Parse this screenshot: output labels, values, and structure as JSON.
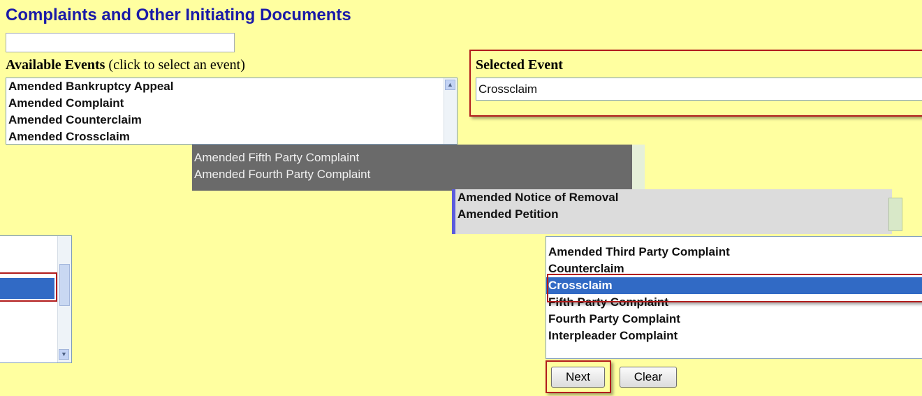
{
  "page": {
    "title": "Complaints and Other Initiating Documents",
    "filter_value": ""
  },
  "available": {
    "label_bold": "Available Events",
    "label_hint": "(click to select an event)",
    "items": [
      "Amended Bankruptcy Appeal",
      "Amended Complaint",
      "Amended Counterclaim",
      "Amended Crossclaim"
    ]
  },
  "selected": {
    "label": "Selected Event",
    "value": "Crossclaim"
  },
  "strip_gray": {
    "items": [
      "Amended Fifth Party Complaint",
      "Amended Fourth Party Complaint"
    ]
  },
  "strip_light": {
    "items": [
      "Amended Notice of Removal",
      "Amended Petition"
    ]
  },
  "zoomed_list": {
    "items": [
      "Amended Third Party Complaint",
      "Counterclaim",
      "Crossclaim",
      "Fifth Party Complaint",
      "Fourth Party Complaint",
      "Interpleader Complaint"
    ],
    "selected_index": 2
  },
  "buttons": {
    "next": "Next",
    "clear": "Clear"
  },
  "colors": {
    "background": "#ffffa0",
    "title": "#1a1aa8",
    "selection": "#316ac5",
    "highlight_frame": "#b21c1c"
  }
}
